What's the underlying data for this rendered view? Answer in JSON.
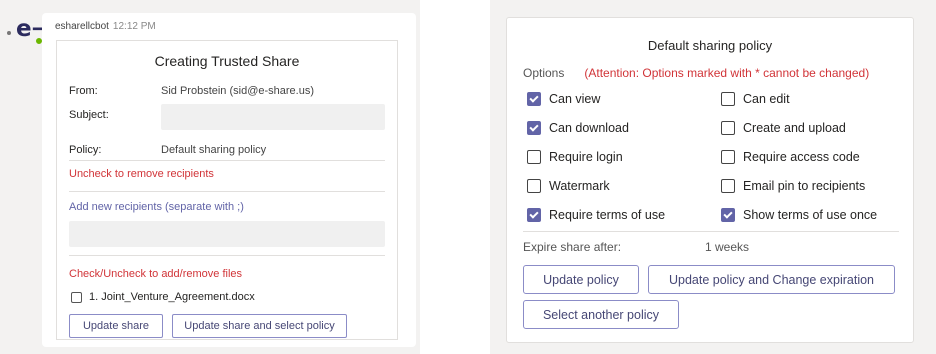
{
  "chat": {
    "sender": "esharellcbot",
    "time": "12:12 PM",
    "avatar_glyph": "e→",
    "card": {
      "title": "Creating Trusted Share",
      "from_label": "From:",
      "from_value": "Sid Probstein (sid@e-share.us)",
      "subject_label": "Subject:",
      "subject_value": "",
      "policy_label": "Policy:",
      "policy_value": "Default sharing policy",
      "uncheck_recipients": "Uncheck to remove recipients",
      "add_recipients": "Add new recipients (separate with ;)",
      "recipients_value": "",
      "check_files": "Check/Uncheck to add/remove files",
      "files": [
        {
          "name": "1. Joint_Venture_Agreement.docx",
          "checked": false
        }
      ],
      "update_share": "Update share",
      "update_share_policy": "Update share and select policy"
    }
  },
  "policy_card": {
    "title": "Default sharing policy",
    "options_label": "Options",
    "attention": "(Attention: Options marked with * cannot be changed)",
    "options": [
      {
        "label": "Can view",
        "checked": true
      },
      {
        "label": "Can edit",
        "checked": false
      },
      {
        "label": "Can download",
        "checked": true
      },
      {
        "label": "Create and upload",
        "checked": false
      },
      {
        "label": "Require login",
        "checked": false
      },
      {
        "label": "Require access code",
        "checked": false
      },
      {
        "label": "Watermark",
        "checked": false
      },
      {
        "label": "Email pin to recipients",
        "checked": false
      },
      {
        "label": "Require terms of use",
        "checked": true
      },
      {
        "label": "Show terms of use once",
        "checked": true
      }
    ],
    "expire_label": "Expire share after:",
    "expire_value": "1 weeks",
    "update_policy": "Update policy",
    "update_policy_expiration": "Update policy and Change expiration",
    "select_another": "Select another policy"
  },
  "colors": {
    "accent": "#6264a7",
    "warning": "#d13438",
    "status": "#6bb700"
  }
}
